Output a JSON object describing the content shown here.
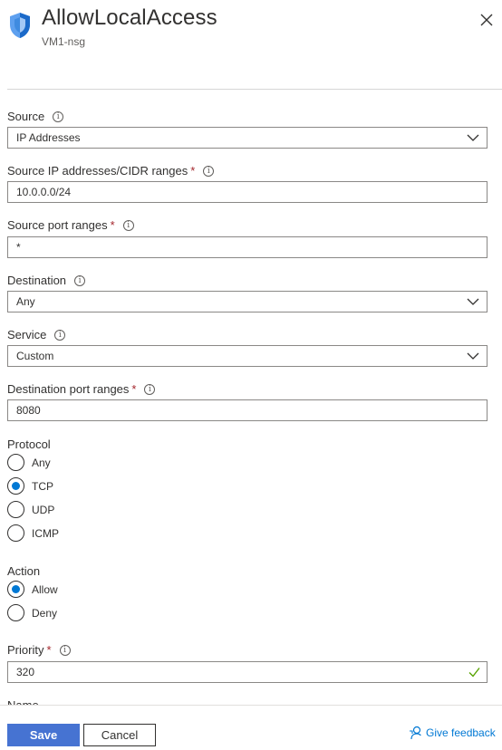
{
  "header": {
    "title": "AllowLocalAccess",
    "subtitle": "VM1-nsg",
    "icon": "shield-icon",
    "close_icon": "close-icon"
  },
  "form": {
    "source": {
      "label": "Source",
      "value": "IP Addresses"
    },
    "source_ip": {
      "label": "Source IP addresses/CIDR ranges",
      "required": "*",
      "value": "10.0.0.0/24"
    },
    "source_port": {
      "label": "Source port ranges",
      "required": "*",
      "value": "*"
    },
    "destination": {
      "label": "Destination",
      "value": "Any"
    },
    "service": {
      "label": "Service",
      "value": "Custom"
    },
    "dest_port": {
      "label": "Destination port ranges",
      "required": "*",
      "value": "8080"
    },
    "protocol": {
      "label": "Protocol",
      "options": [
        "Any",
        "TCP",
        "UDP",
        "ICMP"
      ],
      "selected": "TCP"
    },
    "action": {
      "label": "Action",
      "options": [
        "Allow",
        "Deny"
      ],
      "selected": "Allow"
    },
    "priority": {
      "label": "Priority",
      "required": "*",
      "value": "320"
    },
    "name": {
      "label": "Name"
    }
  },
  "footer": {
    "save_label": "Save",
    "cancel_label": "Cancel",
    "feedback_label": "Give feedback"
  },
  "colors": {
    "primary": "#4673d2",
    "link": "#0078d4",
    "required": "#a4262c",
    "valid_check": "#57a300"
  }
}
